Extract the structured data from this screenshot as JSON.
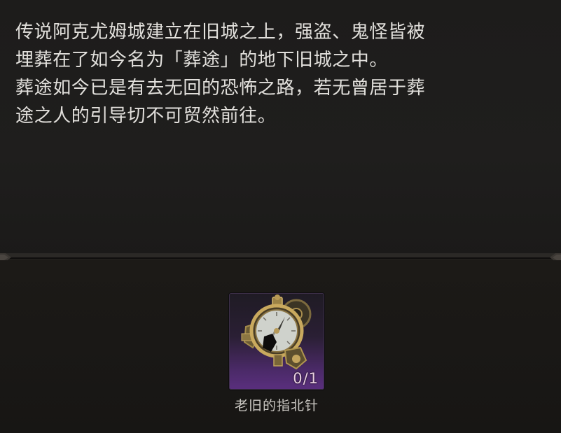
{
  "lore": {
    "text": "传说阿克尤姆城建立在旧城之上，强盗、鬼怪皆被\n埋葬在了如今名为「葬途」的地下旧城之中。\n葬途如今已是有去无回的恐怖之路，若无曾居于葬\n途之人的引导切不可贸然前往。"
  },
  "reward": {
    "item_name": "老旧的指北针",
    "count": "0/1",
    "icon": "old-compass-icon",
    "rarity_color": "#5a2f7e"
  }
}
